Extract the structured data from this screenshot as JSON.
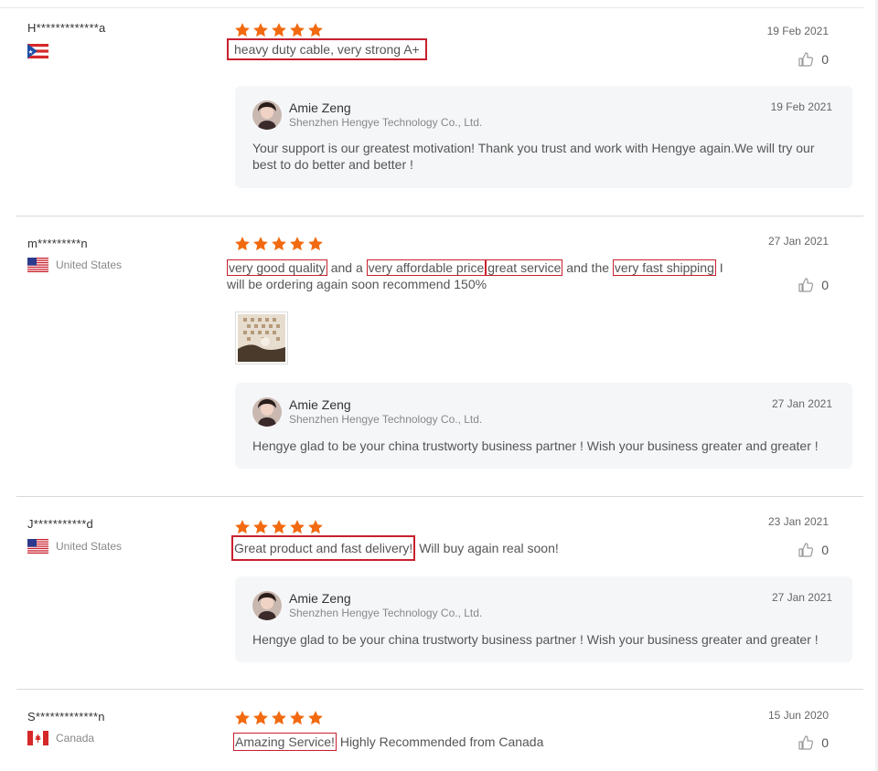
{
  "reviews": [
    {
      "buyer": "H*************a",
      "country_name": "",
      "flag": "puerto-rico-flag",
      "rating": 5,
      "date": "19 Feb 2021",
      "likes": "0",
      "content_segments": [
        {
          "text": "heavy duty cable, very strong A+",
          "hl": true
        }
      ],
      "reply": {
        "name": "Amie Zeng",
        "company": "Shenzhen Hengye Technology Co., Ltd.",
        "date": "19 Feb 2021",
        "text": "Your support is our greatest motivation! Thank you trust and work with Hengye again.We will try our best to do better and better !"
      }
    },
    {
      "buyer": "m*********n",
      "country_name": "United States",
      "flag": "us-flag",
      "rating": 5,
      "date": "27 Jan 2021",
      "likes": "0",
      "content_segments": [
        {
          "text": "very good quality",
          "hl": true
        },
        {
          "text": " and a ",
          "hl": false
        },
        {
          "text": "very affordable price",
          "hl": true
        },
        {
          "text": "great service",
          "hl": true
        },
        {
          "text": " and the ",
          "hl": false
        },
        {
          "text": "very fast shipping",
          "hl": true
        },
        {
          "text": " I will be ordering again soon recommend 150%",
          "hl": false
        }
      ],
      "has_photo": true,
      "reply": {
        "name": "Amie Zeng",
        "company": "Shenzhen Hengye Technology Co., Ltd.",
        "date": "27 Jan 2021",
        "text": "Hengye glad to be your china trustworty business partner ! Wish your business greater and greater !"
      }
    },
    {
      "buyer": "J***********d",
      "country_name": "United States",
      "flag": "us-flag",
      "rating": 5,
      "date": "23 Jan 2021",
      "likes": "0",
      "content_segments": [
        {
          "text": "Great product and fast delivery!",
          "hl": true
        },
        {
          "text": " Will buy again real soon!",
          "hl": false
        }
      ],
      "reply": {
        "name": "Amie Zeng",
        "company": "Shenzhen Hengye Technology Co., Ltd.",
        "date": "27 Jan 2021",
        "text": "Hengye glad to be your china trustworty business partner ! Wish your business greater and greater !"
      }
    },
    {
      "buyer": "S*************n",
      "country_name": "Canada",
      "flag": "canada-flag",
      "rating": 5,
      "date": "15 Jun 2020",
      "likes": "0",
      "content_segments": [
        {
          "text": "Amazing Service!",
          "hl": true
        },
        {
          "text": " Highly Recommended from Canada",
          "hl": false
        }
      ]
    }
  ],
  "colors": {
    "star": "#f26a10",
    "highlight_border": "#c8202f",
    "reply_bg": "#f5f6f8"
  }
}
